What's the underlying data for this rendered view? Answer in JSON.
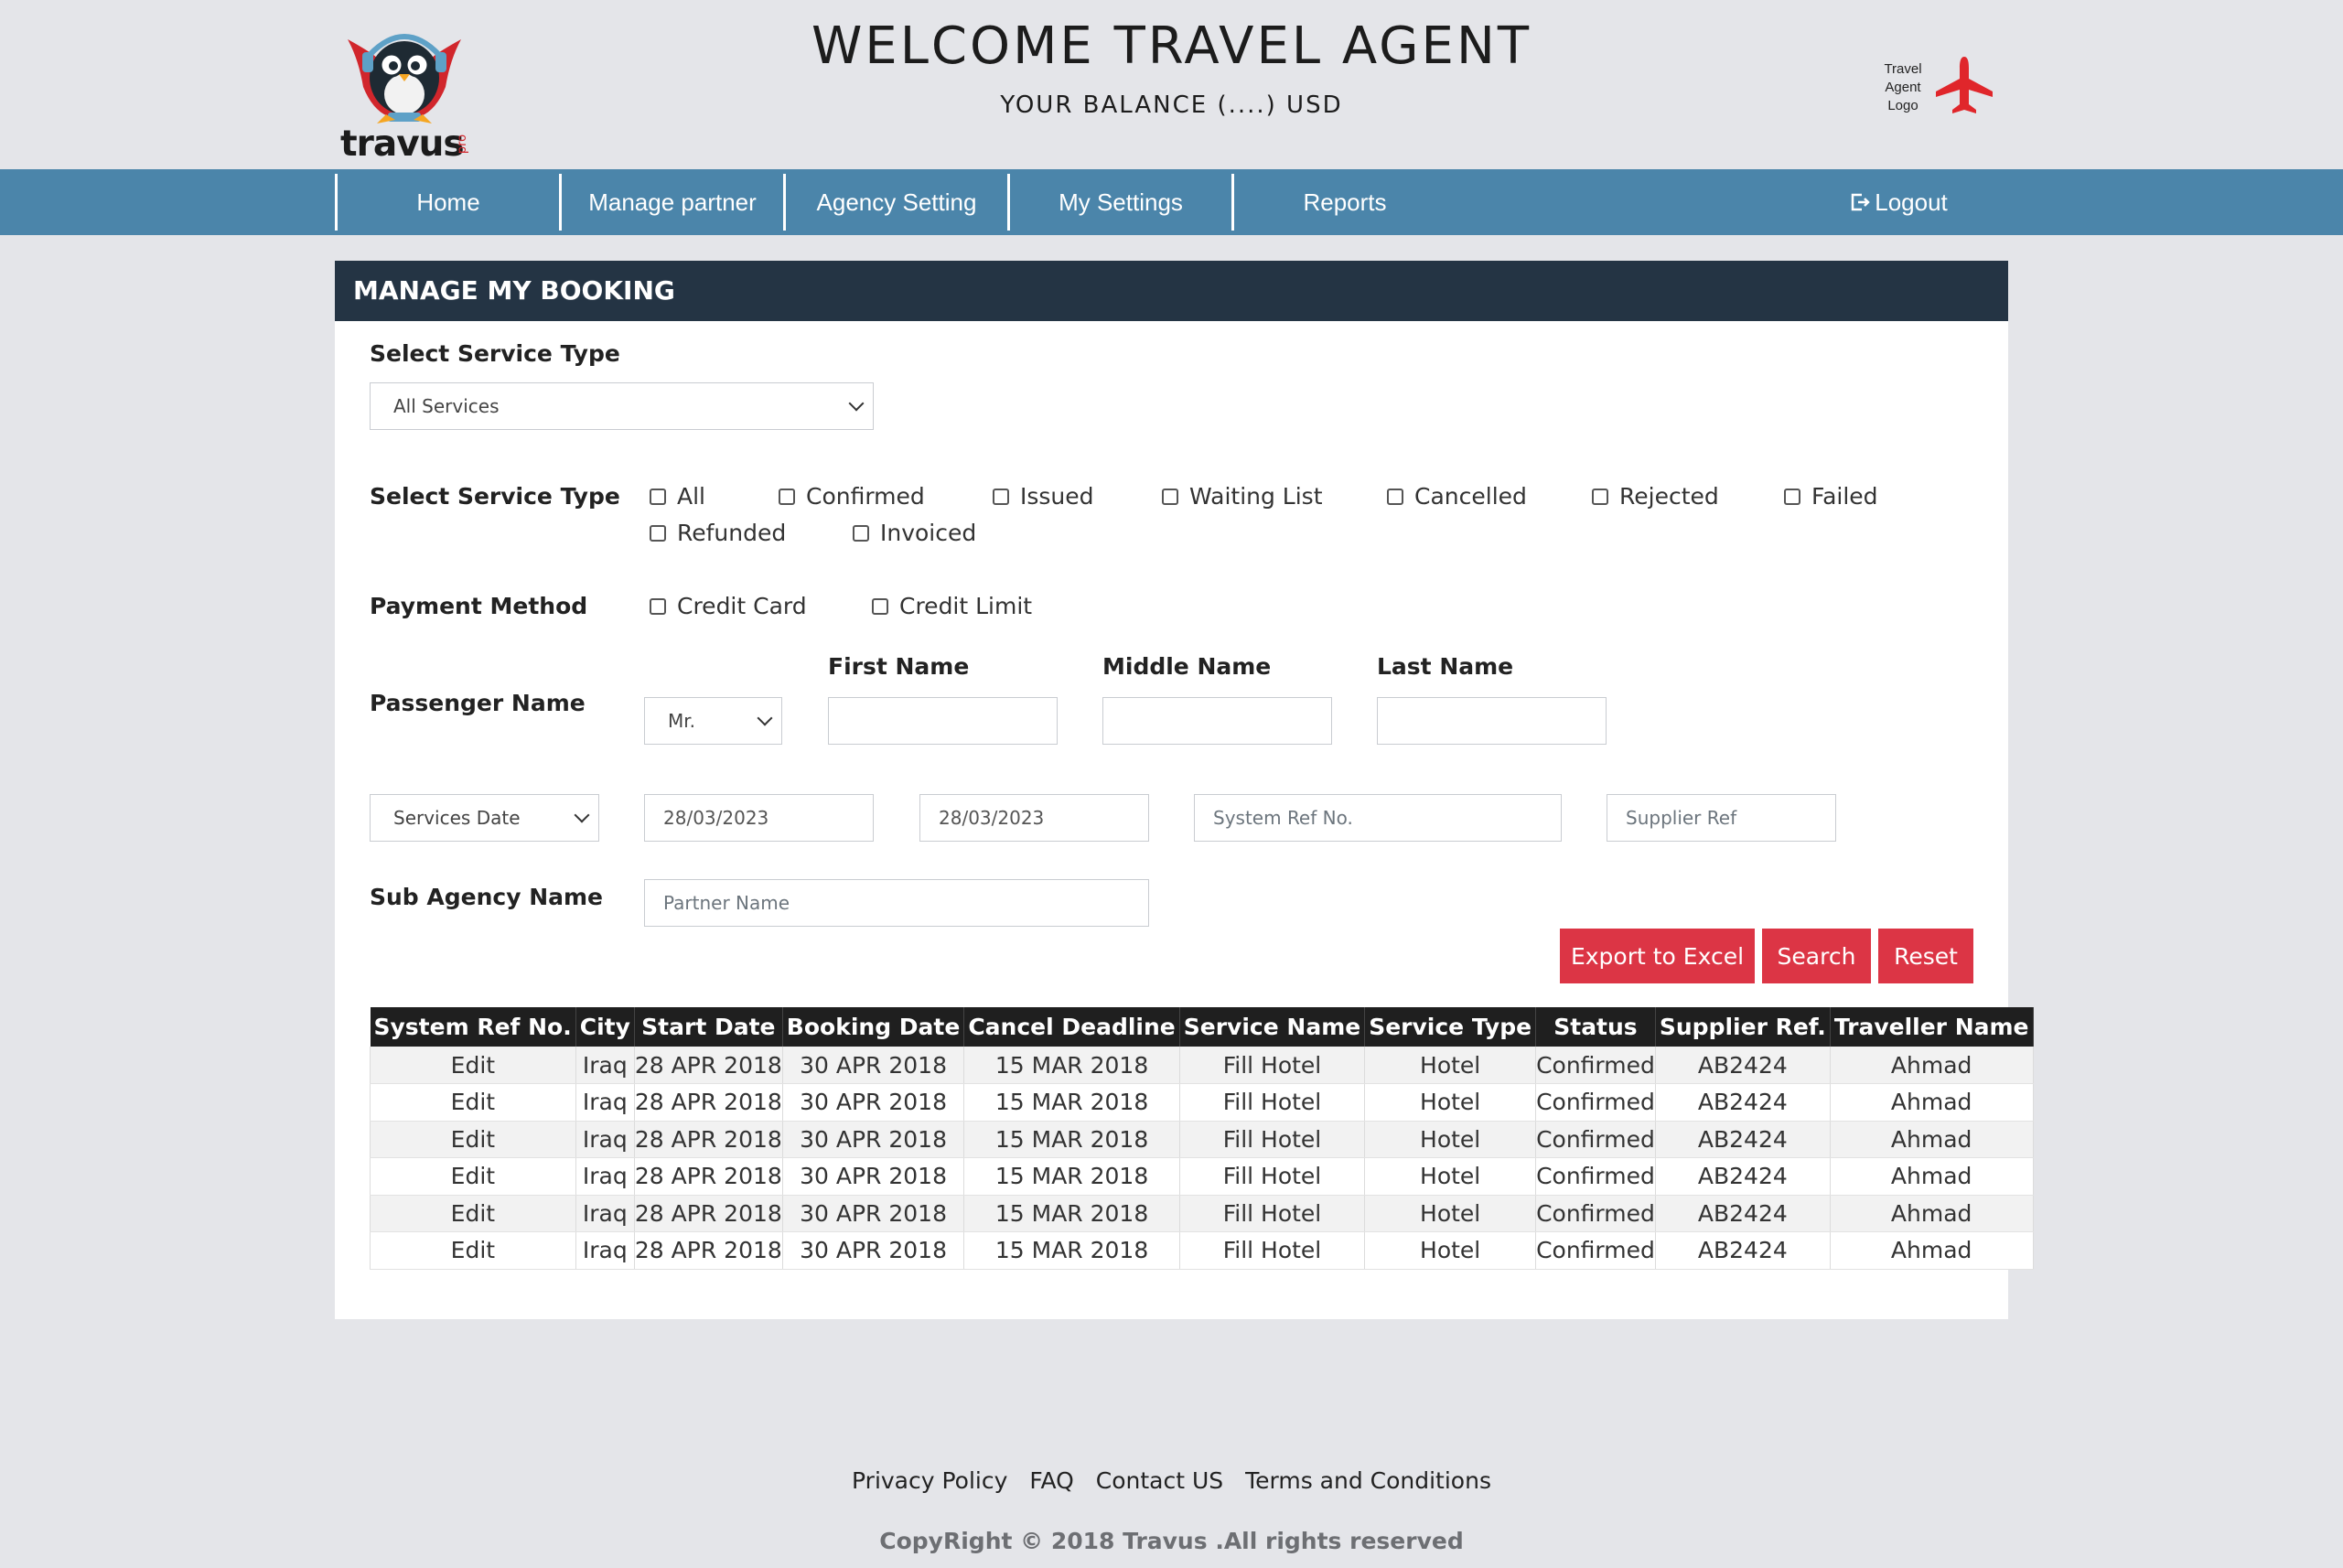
{
  "header": {
    "logo_text": "travus",
    "logo_suffix": "pro",
    "welcome": "WELCOME TRAVEL AGENT",
    "balance": "YOUR BALANCE (....) USD",
    "agent_logo_lines": [
      "Travel",
      "Agent",
      "Logo"
    ]
  },
  "nav": {
    "items": [
      "Home",
      "Manage partner",
      "Agency Setting",
      "My Settings",
      "Reports"
    ],
    "logout": "Logout"
  },
  "panel": {
    "title": "MANAGE MY BOOKING"
  },
  "form": {
    "service_type_label": "Select Service Type",
    "service_select_value": "All Services",
    "status_label": "Select Service Type",
    "status_options": [
      "All",
      "Confirmed",
      "Issued",
      "Waiting List",
      "Cancelled",
      "Rejected",
      "Failed",
      "Refunded",
      "Invoiced"
    ],
    "payment_label": "Payment Method",
    "payment_options": [
      "Credit Card",
      "Credit Limit"
    ],
    "passenger_label": "Passenger Name",
    "title_select_value": "Mr.",
    "first_name_label": "First Name",
    "middle_name_label": "Middle Name",
    "last_name_label": "Last Name",
    "date_type_value": "Services Date",
    "date_from": "28/03/2023",
    "date_to": "28/03/2023",
    "system_ref_placeholder": "System Ref No.",
    "supplier_ref_placeholder": "Supplier Ref",
    "sub_agency_label": "Sub Agency Name",
    "partner_placeholder": "Partner Name"
  },
  "buttons": {
    "export": "Export to Excel",
    "search": "Search",
    "reset": "Reset"
  },
  "table": {
    "headers": [
      "System Ref No.",
      "City",
      "Start Date",
      "Booking Date",
      "Cancel Deadline",
      "Service Name",
      "Service Type",
      "Status",
      "Supplier Ref.",
      "Traveller Name"
    ],
    "rows": [
      [
        "Edit",
        "Iraq",
        "28 APR 2018",
        "30 APR 2018",
        "15 MAR 2018",
        "Fill Hotel",
        "Hotel",
        "Confirmed",
        "AB2424",
        "Ahmad"
      ],
      [
        "Edit",
        "Iraq",
        "28 APR 2018",
        "30 APR 2018",
        "15 MAR 2018",
        "Fill Hotel",
        "Hotel",
        "Confirmed",
        "AB2424",
        "Ahmad"
      ],
      [
        "Edit",
        "Iraq",
        "28 APR 2018",
        "30 APR 2018",
        "15 MAR 2018",
        "Fill Hotel",
        "Hotel",
        "Confirmed",
        "AB2424",
        "Ahmad"
      ],
      [
        "Edit",
        "Iraq",
        "28 APR 2018",
        "30 APR 2018",
        "15 MAR 2018",
        "Fill Hotel",
        "Hotel",
        "Confirmed",
        "AB2424",
        "Ahmad"
      ],
      [
        "Edit",
        "Iraq",
        "28 APR 2018",
        "30 APR 2018",
        "15 MAR 2018",
        "Fill Hotel",
        "Hotel",
        "Confirmed",
        "AB2424",
        "Ahmad"
      ],
      [
        "Edit",
        "Iraq",
        "28 APR 2018",
        "30 APR 2018",
        "15 MAR 2018",
        "Fill Hotel",
        "Hotel",
        "Confirmed",
        "AB2424",
        "Ahmad"
      ]
    ]
  },
  "footer": {
    "links": [
      "Privacy Policy",
      "FAQ",
      "Contact US",
      "Terms and Conditions"
    ],
    "copyright": "CopyRight © 2018 Travus .All rights reserved"
  },
  "colors": {
    "navbar": "#4b85aa",
    "panel_header": "#243444",
    "button": "#dc3545",
    "table_header": "#1f1f1f",
    "page_bg": "#e4e5e9"
  },
  "icons": {
    "logo": "penguin-mascot-icon",
    "agent_logo": "airplane-icon",
    "logout": "sign-out-icon"
  }
}
